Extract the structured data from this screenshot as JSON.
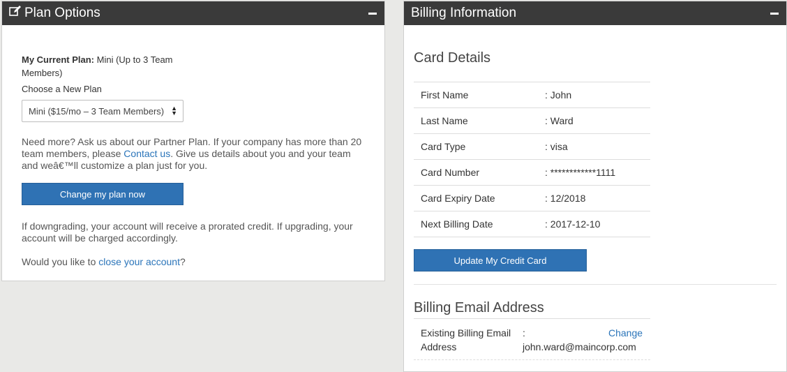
{
  "plan_panel": {
    "title": "Plan Options",
    "current_plan_label": "My Current Plan:",
    "current_plan_value": "Mini (Up to 3 Team Members)",
    "choose_label": "Choose a New Plan",
    "select_value": "Mini ($15/mo – 3 Team Members)",
    "need_more_pre": "Need more? Ask us about our Partner Plan. If your company has more than 20 team members, please ",
    "contact_link": "Contact us",
    "need_more_post": ". Give us details about you and your team and weâ€™ll customize a plan just for you.",
    "change_button": "Change my plan now",
    "downgrade_text": "If downgrading, your account will receive a prorated credit. If upgrading, your account will be charged accordingly.",
    "close_pre": "Would you like to ",
    "close_link": "close your account",
    "close_post": "?"
  },
  "billing_panel": {
    "title": "Billing Information",
    "card_details_title": "Card Details",
    "rows": [
      {
        "label": "First Name",
        "value": ": John"
      },
      {
        "label": "Last Name",
        "value": ": Ward"
      },
      {
        "label": "Card Type",
        "value": ": visa"
      },
      {
        "label": "Card Number",
        "value": ": ************1111"
      },
      {
        "label": "Card Expiry Date",
        "value": ": 12/2018"
      },
      {
        "label": "Next Billing Date",
        "value": ": 2017-12-10"
      }
    ],
    "update_button": "Update My Credit Card",
    "email_title": "Billing Email Address",
    "email_label": "Existing Billing Email Address",
    "email_value": ": john.ward@maincorp.com",
    "email_change": "Change"
  },
  "icons": {
    "edit": "edit-icon",
    "collapse": "minus-icon"
  },
  "colors": {
    "header_bg": "#3a3a3a",
    "primary": "#2f72b4",
    "link": "#2a74b9"
  }
}
